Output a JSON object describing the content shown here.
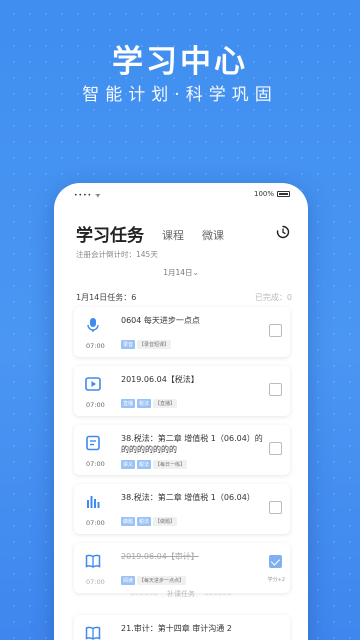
{
  "hero": {
    "title": "学习中心",
    "subtitle": "智能计划·科学巩固"
  },
  "status_bar": {
    "signal": "•••• ᯤ",
    "battery": "100%"
  },
  "header": {
    "active_tab": "学习任务",
    "tabs": [
      "课程",
      "微课"
    ],
    "clock_icon": "clock-icon"
  },
  "countdown": "注册会计倒计时：145天",
  "date_selector": "1月14日",
  "summary": {
    "tasks_label": "1月14日任务：6",
    "completed_label": "已完成：0"
  },
  "tasks": [
    {
      "icon": "microphone-icon",
      "title": "0604 每天进步一点点",
      "time": "07:00",
      "tags": [
        {
          "kind": "blue",
          "text": "录音"
        },
        {
          "kind": "gray",
          "text": "【录音短课】"
        }
      ],
      "checked": false
    },
    {
      "icon": "video-play-icon",
      "title": "2019.06.04【税法】",
      "time": "07:00",
      "tags": [
        {
          "kind": "blue",
          "text": "直播"
        },
        {
          "kind": "blue",
          "text": "税法"
        },
        {
          "kind": "gray",
          "text": "【直播】"
        }
      ],
      "checked": false
    },
    {
      "icon": "document-icon",
      "title": "38.税法：第二章 增值税 1（06.04）的的的的的的的的",
      "time": "07:00",
      "tags": [
        {
          "kind": "blue",
          "text": "讲义"
        },
        {
          "kind": "blue",
          "text": "税法"
        },
        {
          "kind": "gray",
          "text": "【每日一练】"
        }
      ],
      "checked": false
    },
    {
      "icon": "bar-chart-icon",
      "title": "38.税法：第二章 增值税 1（06.04）",
      "time": "07:00",
      "tags": [
        {
          "kind": "blue",
          "text": "做题"
        },
        {
          "kind": "blue",
          "text": "税法"
        },
        {
          "kind": "gray",
          "text": "【做题】"
        }
      ],
      "checked": false
    },
    {
      "icon": "book-icon",
      "title": "2019.06.04【审计】",
      "time": "07:00",
      "tags": [
        {
          "kind": "blue",
          "text": "阅读"
        },
        {
          "kind": "gray",
          "text": "【每天进步一点点】"
        }
      ],
      "checked": true,
      "done_label": "学分+2"
    }
  ],
  "supplement_label": "补课任务",
  "last_task": {
    "icon": "book-icon",
    "title": "21.审计：第十四章 审计沟通 2"
  },
  "colors": {
    "background": "#4a96f2",
    "accent": "#2f7ee8",
    "tag_blue": "#9bc2f5"
  }
}
